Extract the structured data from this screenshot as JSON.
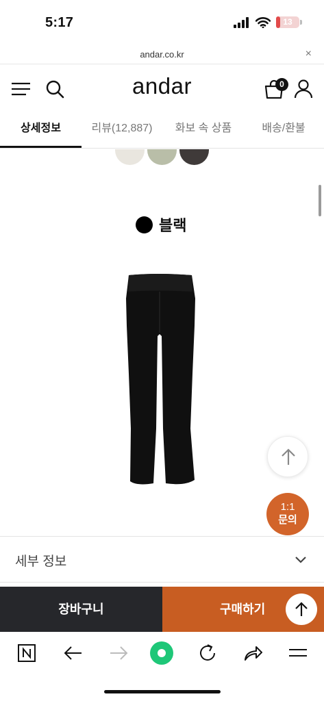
{
  "status_bar": {
    "time": "5:17",
    "battery": "13",
    "battery_level": 0.13
  },
  "browser": {
    "url": "andar.co.kr",
    "close_label": "×"
  },
  "header": {
    "logo": "andar",
    "cart_count": "0"
  },
  "tabs": [
    {
      "label": "상세정보",
      "active": true
    },
    {
      "label": "리뷰(12,887)",
      "active": false
    },
    {
      "label": "화보 속 상품",
      "active": false
    },
    {
      "label": "배송/환불",
      "active": false
    }
  ],
  "product": {
    "swatches": [
      "#e9e6df",
      "#b9bea8",
      "#3f3a39"
    ],
    "color_dot": "#000000",
    "color_name": "블랙"
  },
  "floating": {
    "inquiry_line1": "1:1",
    "inquiry_line2": "문의"
  },
  "details": {
    "label": "세부 정보"
  },
  "actions": {
    "cart_label": "장바구니",
    "buy_label": "구매하기"
  },
  "colors": {
    "accent": "#c85d22",
    "dark": "#26272b",
    "toolbar_green": "#1ec778"
  }
}
